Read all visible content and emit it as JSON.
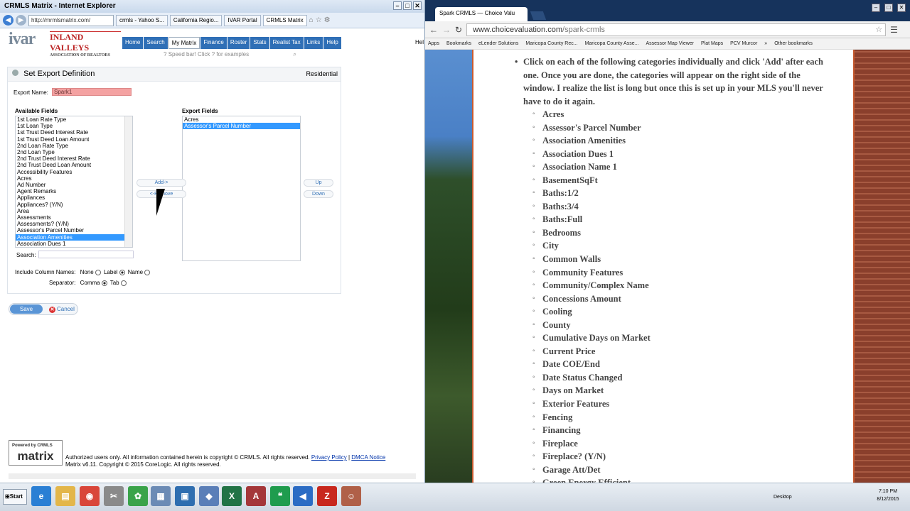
{
  "ie": {
    "title": "CRMLS Matrix - Internet Explorer",
    "address": "http://mrmlsmatrix.com/",
    "tabs": [
      "crmls - Yahoo S...",
      "California Regio...",
      "IVAR Portal",
      "CRMLS Matrix"
    ],
    "logo_main": "ivar",
    "logo_sub": "INLAND VALLEYS",
    "logo_sub2": "ASSOCIATION OF REALTORS",
    "menu": [
      "Home",
      "Search",
      "My Matrix",
      "Finance",
      "Roster",
      "Stats",
      "Realist Tax",
      "Links",
      "Help"
    ],
    "menu_overflow": "Hel",
    "speedbar": "Speed bar! Click ? for examples"
  },
  "panel": {
    "title": "Set Export Definition",
    "property_type": "Residential",
    "export_name_label": "Export Name:",
    "export_name_value": "Spark1",
    "available_label": "Available Fields",
    "export_label": "Export Fields",
    "available_fields": [
      "1st Loan Rate Type",
      "1st Loan Type",
      "1st Trust Deed Interest Rate",
      "1st Trust Deed Loan Amount",
      "2nd Loan Rate Type",
      "2nd Loan Type",
      "2nd Trust Deed Interest Rate",
      "2nd Trust Deed Loan Amount",
      "Accessibility Features",
      "Acres",
      "Ad Number",
      "Agent Remarks",
      "Appliances",
      "Appliances? (Y/N)",
      "Area",
      "Assessments",
      "Assessments? (Y/N)",
      "Assessor's Parcel Number",
      "Association Amenities",
      "Association Dues 1"
    ],
    "available_selected": "Association Amenities",
    "export_fields": [
      "Acres",
      "Assessor's Parcel Number"
    ],
    "export_selected": "Assessor's Parcel Number",
    "add_btn": "Add->",
    "remove_btn": "<-Remove",
    "up_btn": "Up",
    "down_btn": "Down",
    "search_label": "Search:",
    "include_label": "Include Column Names:",
    "opt_none": "None",
    "opt_label": "Label",
    "opt_name": "Name",
    "separator_label": "Separator:",
    "opt_comma": "Comma",
    "opt_tab": "Tab",
    "save": "Save",
    "cancel": "Cancel"
  },
  "footer": {
    "badge_small": "Powered by",
    "badge_brand": "CRMLS",
    "badge_main": "matrix",
    "line1": "Authorized users only. All information contained herein is copyright © CRMLS. All rights reserved.",
    "privacy": "Privacy Policy",
    "sep": "|",
    "dmca": "DMCA Notice",
    "line2": "Matrix v6.11. Copyright © 2015 CoreLogic. All rights reserved."
  },
  "chrome": {
    "tab_title": "Spark CRMLS — Choice Valu",
    "url_host": "www.choicevaluation.com",
    "url_path": "/spark-crmls",
    "bookmarks": [
      "Apps",
      "Bookmarks",
      "eLender Solutions",
      "Maricopa County Rec...",
      "Maricopa County Asse...",
      "Assessor Map Viewer",
      "Plat Maps",
      "PCV Murcor",
      "»",
      "Other bookmarks"
    ]
  },
  "article": {
    "intro": "Click on each of the following categories individually and click 'Add' after each one. Once you are done, the categories will appear on the right side of the window. I realize the list is long but once this is set up in your MLS you'll never have to do it again.",
    "categories": [
      "Acres",
      "Assessor's Parcel Number",
      "Association Amenities",
      "Association Dues 1",
      "Association Name 1",
      "BasementSqFt",
      "Baths:1/2",
      "Baths:3/4",
      "Baths:Full",
      "Bedrooms",
      "City",
      "Common Walls",
      "Community Features",
      "Community/Complex Name",
      "Concessions Amount",
      "Cooling",
      "County",
      "Cumulative Days on Market",
      "Current Price",
      "Date COE/End",
      "Date Status Changed",
      "Days on Market",
      "Exterior Features",
      "Fencing",
      "Financing",
      "Fireplace",
      "Fireplace? (Y/N)",
      "Garage Att/Det",
      "Green Energy Efficient"
    ]
  },
  "taskbar": {
    "start": "Start",
    "desktop": "Desktop",
    "time": "7:10 PM",
    "date": "8/12/2015"
  }
}
